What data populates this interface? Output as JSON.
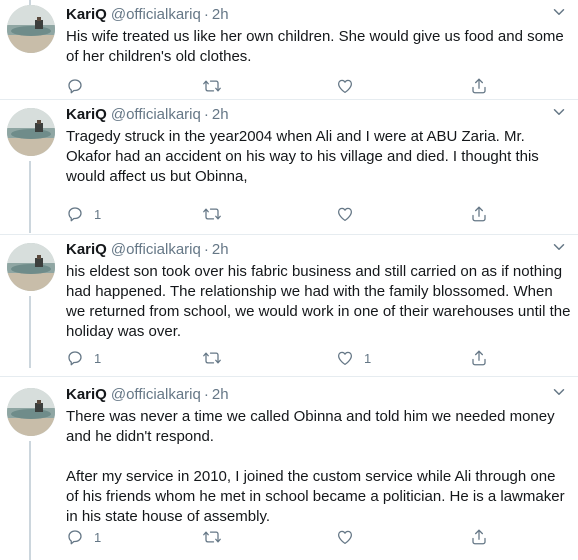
{
  "colors": {
    "text": "#14171a",
    "secondary": "#657786",
    "divider": "#e6ecf0",
    "thread_line": "#ccd6dd"
  },
  "icons": [
    "avatar",
    "chevron-down-icon",
    "reply-icon",
    "retweet-icon",
    "like-icon",
    "share-icon"
  ],
  "tweets": [
    {
      "author": "KariQ",
      "handle": "@officialkariq",
      "dot": "·",
      "time": "2h",
      "text": "His wife treated us like her own children. She would give us food and some of her children's old clothes.",
      "reply_count": "",
      "retweet_count": "",
      "like_count": ""
    },
    {
      "author": "KariQ",
      "handle": "@officialkariq",
      "dot": "·",
      "time": "2h",
      "text": "Tragedy struck in the year2004 when Ali and I were at ABU Zaria. Mr. Okafor had an accident on his way to his village and died. I thought this would affect us but Obinna,",
      "reply_count": "1",
      "retweet_count": "",
      "like_count": ""
    },
    {
      "author": "KariQ",
      "handle": "@officialkariq",
      "dot": "·",
      "time": "2h",
      "text": "his eldest son took over his fabric business and still carried on as if nothing had happened. The relationship we had with the family blossomed. When we returned from school, we would work in one of their warehouses until the holiday was over.",
      "reply_count": "1",
      "retweet_count": "",
      "like_count": "1"
    },
    {
      "author": "KariQ",
      "handle": "@officialkariq",
      "dot": "·",
      "time": "2h",
      "text": "There was never a time we called Obinna and told him we needed money and he didn't respond.\n\nAfter my service in 2010, I joined the custom service while Ali through one of his friends whom he met in school became a politician. He is a lawmaker in his state house of assembly.",
      "reply_count": "1",
      "retweet_count": "",
      "like_count": ""
    }
  ]
}
